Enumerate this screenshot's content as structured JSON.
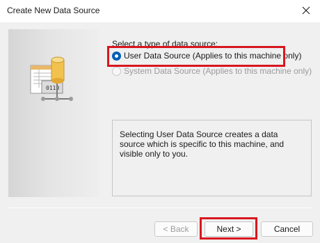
{
  "window": {
    "title": "Create New Data Source",
    "close_icon": "close-icon"
  },
  "side_panel": {
    "illustration_icon": "data-source-illustration-icon",
    "illustration_text": "0110"
  },
  "main": {
    "prompt": "Select a type of data source:",
    "options": [
      {
        "label": "User Data Source (Applies to this machine only)",
        "selected": true,
        "enabled": true
      },
      {
        "label": "System Data Source (Applies to this machine only)",
        "selected": false,
        "enabled": false
      }
    ],
    "description": "Selecting User Data Source creates a data source which is specific to this machine, and visible only to you."
  },
  "buttons": {
    "back": "< Back",
    "next": "Next >",
    "cancel": "Cancel"
  },
  "colors": {
    "highlight": "#d9161e",
    "radio_selected": "#005fb8"
  }
}
